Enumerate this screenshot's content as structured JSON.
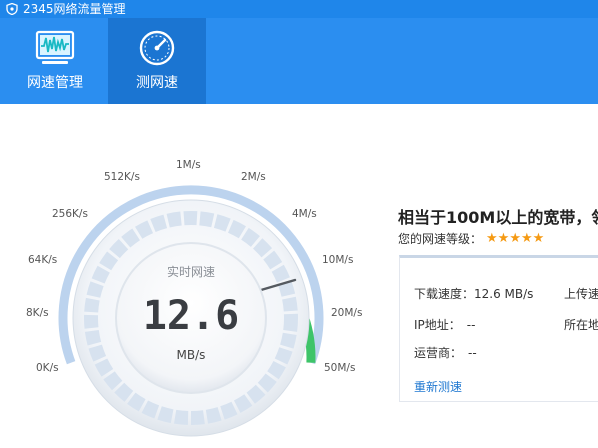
{
  "app": {
    "title": "2345网络流量管理"
  },
  "tabs": [
    {
      "label": "网速管理",
      "icon": "monitor-wave-icon",
      "active": false
    },
    {
      "label": "测网速",
      "icon": "speedometer-icon",
      "active": true
    }
  ],
  "gauge": {
    "caption": "实时网速",
    "value": "12.6",
    "unit": "MB/s",
    "scale_labels": [
      "0K/s",
      "8K/s",
      "64K/s",
      "256K/s",
      "512K/s",
      "1M/s",
      "2M/s",
      "4M/s",
      "10M/s",
      "20M/s",
      "50M/s"
    ]
  },
  "result": {
    "headline": "相当于100M以上的宽带，领",
    "rating_label": "您的网速等级：",
    "stars": "★★★★★",
    "download_label": "下载速度：",
    "download_value": "12.6 MB/s",
    "upload_label": "上传速",
    "ip_label": "IP地址：",
    "ip_value": "--",
    "location_label": "所在地",
    "isp_label": "运营商：",
    "isp_value": "--",
    "retest_link": "重新测速"
  },
  "colors": {
    "titlebar": "#1f86ea",
    "toolbar": "#2b8ef0",
    "active_tab": "#1b75d2",
    "gauge_ring": "#bcd3ee",
    "gauge_green": "#3ec469",
    "link": "#1f78d1",
    "stars": "#f59a13"
  }
}
